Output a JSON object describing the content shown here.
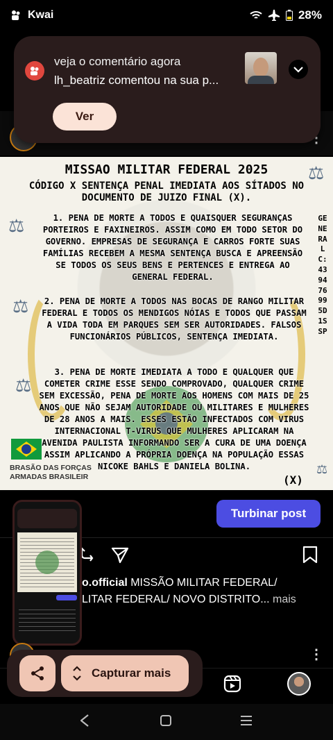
{
  "status_bar": {
    "app_name": "Kwai",
    "battery": "28%"
  },
  "notification": {
    "title": "veja o comentário agora",
    "text": "lh_beatriz comentou na sua p...",
    "action_label": "Ver"
  },
  "post_image": {
    "title": "MISSAO MILITAR FEDERAL 2025",
    "subtitle": "CÓDIGO X SENTENÇA PENAL IMEDIATA AOS SÍTADOS NO DOCUMENTO DE JUIZO FINAL (X).",
    "paragraph_1": "1. PENA DE MORTE A TODOS E QUAISQUER SEGURANÇAS PORTEIROS E FAXINEIROS. ASSIM COMO EM TODO SETOR DO GOVERNO. EMPRESAS DE SEGURANÇA E CARROS FORTE SUAS FAMÍLIAS RECEBEM A MESMA SENTENÇA BUSCA E APREENSÃO SE TODOS OS SEUS BENS E PERTENCES E ENTREGA AO GENERAL FEDERAL.",
    "paragraph_2": "2. PENA DE MORTE A TODOS NAS BOCAS DE RANGO MILITAR FEDERAL E TODOS OS MENDIGOS NÓIAS E TODOS QUE PASSAM A VIDA TODA EM PARQUES SEM SER AUTORIDADES. FALSOS FUNCIONÁRIOS PÚBLICOS, SENTENÇA IMEDIATA.",
    "paragraph_3": "3. PENA DE MORTE IMEDIATA A TODO E QUALQUER QUE COMETER CRIME ESSE SENDO COMPROVADO, QUALQUER CRIME SEM EXCESSÃO, PENA DE MORTE AOS HOMENS COM MAIS DE 25 ANOS QUE NÃO SEJAM AUTORIDADE OU MILITARES E MULHERES DE 28 ANOS A MAIS. ESSES ESTÃO INFECTADOS COM VIRUS INTERNACIONAL T-VIRUS QUE MULHERES APLICARAM NA AVENIDA PAULISTA INFORMANDO SER A CURA DE UMA DOENÇA ASSIM APLICANDO A PRÓPRIA DOENÇA NA POPULAÇÃO ESSAS NICOKE BAHLS E DANIELA BOLINA.",
    "vertical_text": "GENERAL C:439476995D1SSP",
    "brasao_line1": "BRASÃO DAS FORÇAS",
    "brasao_line2": "ARMADAS BRASILEIR",
    "x_mark": "(X)"
  },
  "post_actions": {
    "boost_label": "Turbinar post"
  },
  "caption": {
    "username": "o.official",
    "line1": " MISSÃO MILITAR FEDERAL/",
    "line2": "LITAR FEDERAL/ NOVO DISTRITO...",
    "more": " mais"
  },
  "screenshot_toolbar": {
    "capture_more_label": "Capturar mais"
  },
  "colors": {
    "boost_button": "#4c4de2",
    "notification_bg": "#2a1c1c",
    "pill_bg": "#f0c6b4"
  }
}
